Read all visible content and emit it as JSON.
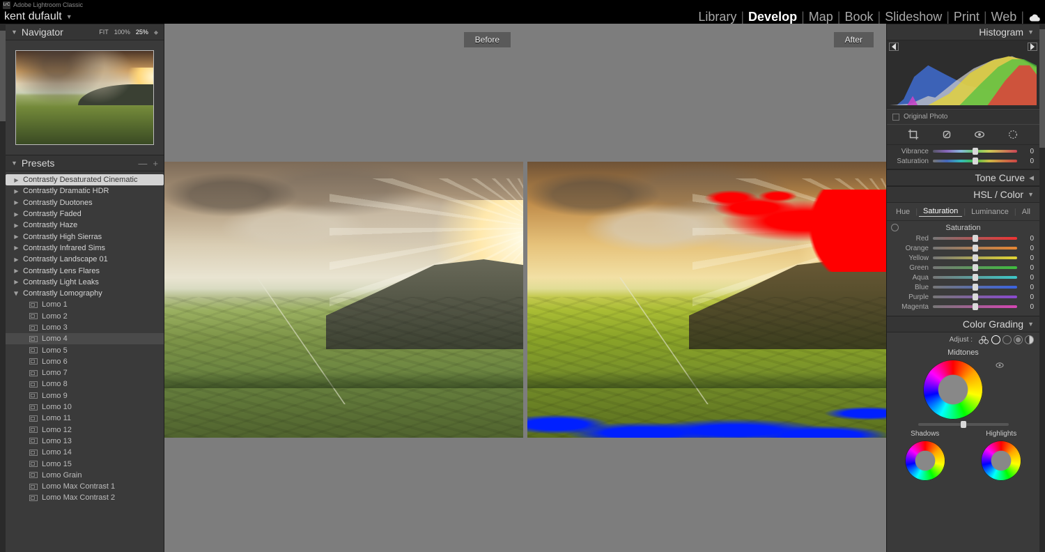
{
  "app": {
    "title": "Adobe Lightroom Classic",
    "identity": "kent dufault",
    "lrc": "LrC"
  },
  "modules": {
    "items": [
      "Library",
      "Develop",
      "Map",
      "Book",
      "Slideshow",
      "Print",
      "Web"
    ],
    "active": "Develop"
  },
  "navigator": {
    "title": "Navigator",
    "fit": "FIT",
    "pct100": "100%",
    "zoom": "25%"
  },
  "presets": {
    "title": "Presets",
    "folders": [
      {
        "label": "Contrastly Desaturated Cinematic",
        "selected": true
      },
      {
        "label": "Contrastly Dramatic HDR"
      },
      {
        "label": "Contrastly Duotones"
      },
      {
        "label": "Contrastly Faded"
      },
      {
        "label": "Contrastly Haze"
      },
      {
        "label": "Contrastly High Sierras"
      },
      {
        "label": "Contrastly Infrared Sims"
      },
      {
        "label": "Contrastly Landscape 01"
      },
      {
        "label": "Contrastly Lens Flares"
      },
      {
        "label": "Contrastly Light Leaks"
      },
      {
        "label": "Contrastly Lomography",
        "expanded": true,
        "children": [
          "Lomo 1",
          "Lomo 2",
          "Lomo 3",
          "Lomo 4",
          "Lomo 5",
          "Lomo 6",
          "Lomo 7",
          "Lomo 8",
          "Lomo 9",
          "Lomo 10",
          "Lomo 11",
          "Lomo 12",
          "Lomo 13",
          "Lomo 14",
          "Lomo 15",
          "Lomo Grain",
          "Lomo Max Contrast 1",
          "Lomo Max Contrast 2"
        ],
        "hover": "Lomo 4"
      }
    ]
  },
  "compare": {
    "before": "Before",
    "after": "After"
  },
  "right": {
    "histogram": {
      "title": "Histogram",
      "original": "Original Photo"
    },
    "basic_tail": {
      "vibrance": {
        "label": "Vibrance",
        "value": 0,
        "pos": 50
      },
      "saturation": {
        "label": "Saturation",
        "value": 0,
        "pos": 50
      }
    },
    "tone_curve": {
      "title": "Tone Curve"
    },
    "hsl": {
      "title": "HSL / Color",
      "tabs": [
        "Hue",
        "Saturation",
        "Luminance",
        "All"
      ],
      "active": "Saturation",
      "heading": "Saturation",
      "rows": [
        {
          "key": "red",
          "label": "Red",
          "value": 0,
          "pos": 50
        },
        {
          "key": "orange",
          "label": "Orange",
          "value": 0,
          "pos": 50
        },
        {
          "key": "yellow",
          "label": "Yellow",
          "value": 0,
          "pos": 50
        },
        {
          "key": "green",
          "label": "Green",
          "value": 0,
          "pos": 50
        },
        {
          "key": "aqua",
          "label": "Aqua",
          "value": 0,
          "pos": 50
        },
        {
          "key": "blue",
          "label": "Blue",
          "value": 0,
          "pos": 50
        },
        {
          "key": "purple",
          "label": "Purple",
          "value": 0,
          "pos": 50
        },
        {
          "key": "magenta",
          "label": "Magenta",
          "value": 0,
          "pos": 50
        }
      ]
    },
    "color_grading": {
      "title": "Color Grading",
      "adjust": "Adjust :",
      "midtones": "Midtones",
      "shadows": "Shadows",
      "highlights": "Highlights"
    }
  }
}
